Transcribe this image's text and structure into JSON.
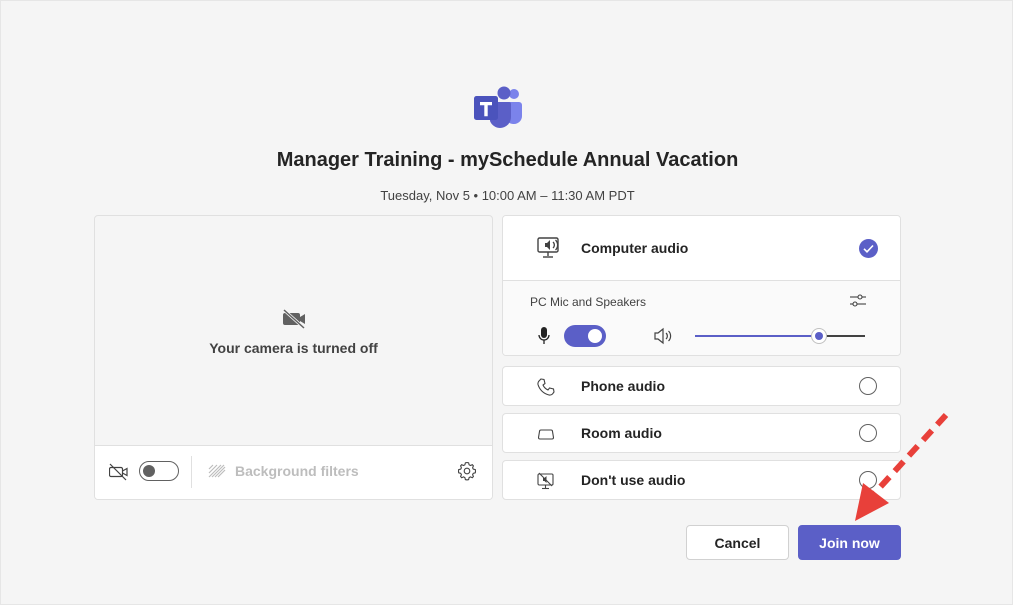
{
  "meeting": {
    "title": "Manager Training - mySchedule Annual Vacation",
    "datetime": "Tuesday, Nov 5 • 10:00 AM – 11:30 AM PDT"
  },
  "video": {
    "camera_status": "Your camera is turned off",
    "camera_toggle_on": false,
    "background_filters_label": "Background filters"
  },
  "audio": {
    "options": [
      {
        "label": "Computer audio",
        "icon": "computer-audio-icon",
        "selected": true
      },
      {
        "label": "Phone audio",
        "icon": "phone-icon",
        "selected": false
      },
      {
        "label": "Room audio",
        "icon": "room-audio-icon",
        "selected": false
      },
      {
        "label": "Don't use audio",
        "icon": "no-audio-icon",
        "selected": false
      }
    ],
    "device_label": "PC Mic and Speakers",
    "mic_on": true,
    "volume_fraction": 0.73
  },
  "actions": {
    "cancel_label": "Cancel",
    "join_label": "Join now"
  },
  "colors": {
    "accent": "#5b5fc7",
    "annotation_arrow": "#e8403a"
  }
}
